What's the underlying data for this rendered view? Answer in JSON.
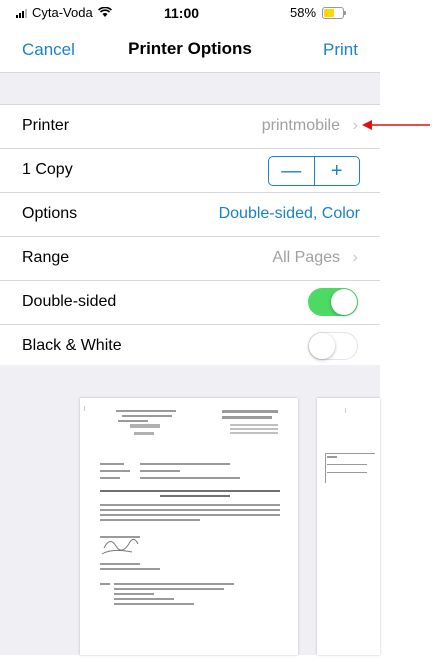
{
  "status_bar": {
    "carrier": "Cyta-Voda",
    "time": "11:00",
    "battery": "58%",
    "battery_level": 0.58,
    "battery_color": "#ffd60a"
  },
  "nav": {
    "cancel": "Cancel",
    "title": "Printer Options",
    "print": "Print"
  },
  "rows": {
    "printer": {
      "label": "Printer",
      "value": "printmobile"
    },
    "copies": {
      "label": "1 Copy",
      "minus": "—",
      "plus": "+"
    },
    "options": {
      "label": "Options",
      "value": "Double-sided, Color"
    },
    "range": {
      "label": "Range",
      "value": "All Pages"
    },
    "double_sided": {
      "label": "Double-sided",
      "on": true
    },
    "black_white": {
      "label": "Black & White",
      "on": false
    }
  },
  "chevron": "›",
  "colors": {
    "accent": "#1a82c9",
    "toggle_on": "#4cd964",
    "annotation_arrow": "#e01010"
  }
}
